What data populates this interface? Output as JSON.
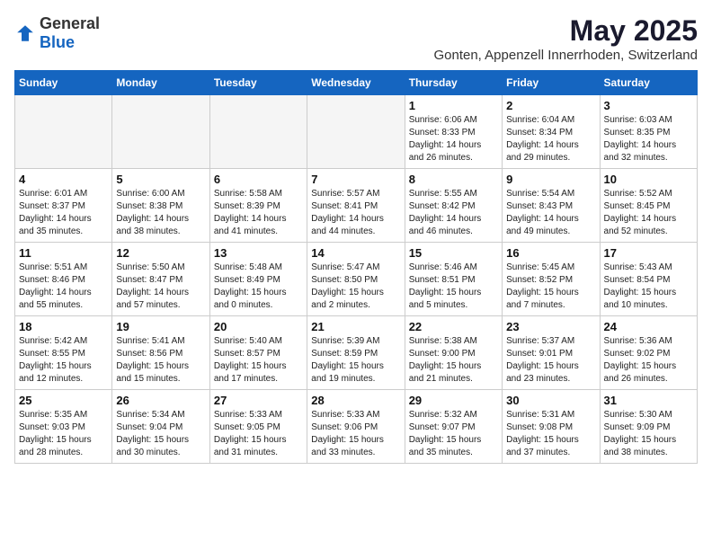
{
  "logo": {
    "general": "General",
    "blue": "Blue"
  },
  "title": "May 2025",
  "location": "Gonten, Appenzell Innerrhoden, Switzerland",
  "headers": [
    "Sunday",
    "Monday",
    "Tuesday",
    "Wednesday",
    "Thursday",
    "Friday",
    "Saturday"
  ],
  "weeks": [
    [
      {
        "day": "",
        "info": ""
      },
      {
        "day": "",
        "info": ""
      },
      {
        "day": "",
        "info": ""
      },
      {
        "day": "",
        "info": ""
      },
      {
        "day": "1",
        "info": "Sunrise: 6:06 AM\nSunset: 8:33 PM\nDaylight: 14 hours\nand 26 minutes."
      },
      {
        "day": "2",
        "info": "Sunrise: 6:04 AM\nSunset: 8:34 PM\nDaylight: 14 hours\nand 29 minutes."
      },
      {
        "day": "3",
        "info": "Sunrise: 6:03 AM\nSunset: 8:35 PM\nDaylight: 14 hours\nand 32 minutes."
      }
    ],
    [
      {
        "day": "4",
        "info": "Sunrise: 6:01 AM\nSunset: 8:37 PM\nDaylight: 14 hours\nand 35 minutes."
      },
      {
        "day": "5",
        "info": "Sunrise: 6:00 AM\nSunset: 8:38 PM\nDaylight: 14 hours\nand 38 minutes."
      },
      {
        "day": "6",
        "info": "Sunrise: 5:58 AM\nSunset: 8:39 PM\nDaylight: 14 hours\nand 41 minutes."
      },
      {
        "day": "7",
        "info": "Sunrise: 5:57 AM\nSunset: 8:41 PM\nDaylight: 14 hours\nand 44 minutes."
      },
      {
        "day": "8",
        "info": "Sunrise: 5:55 AM\nSunset: 8:42 PM\nDaylight: 14 hours\nand 46 minutes."
      },
      {
        "day": "9",
        "info": "Sunrise: 5:54 AM\nSunset: 8:43 PM\nDaylight: 14 hours\nand 49 minutes."
      },
      {
        "day": "10",
        "info": "Sunrise: 5:52 AM\nSunset: 8:45 PM\nDaylight: 14 hours\nand 52 minutes."
      }
    ],
    [
      {
        "day": "11",
        "info": "Sunrise: 5:51 AM\nSunset: 8:46 PM\nDaylight: 14 hours\nand 55 minutes."
      },
      {
        "day": "12",
        "info": "Sunrise: 5:50 AM\nSunset: 8:47 PM\nDaylight: 14 hours\nand 57 minutes."
      },
      {
        "day": "13",
        "info": "Sunrise: 5:48 AM\nSunset: 8:49 PM\nDaylight: 15 hours\nand 0 minutes."
      },
      {
        "day": "14",
        "info": "Sunrise: 5:47 AM\nSunset: 8:50 PM\nDaylight: 15 hours\nand 2 minutes."
      },
      {
        "day": "15",
        "info": "Sunrise: 5:46 AM\nSunset: 8:51 PM\nDaylight: 15 hours\nand 5 minutes."
      },
      {
        "day": "16",
        "info": "Sunrise: 5:45 AM\nSunset: 8:52 PM\nDaylight: 15 hours\nand 7 minutes."
      },
      {
        "day": "17",
        "info": "Sunrise: 5:43 AM\nSunset: 8:54 PM\nDaylight: 15 hours\nand 10 minutes."
      }
    ],
    [
      {
        "day": "18",
        "info": "Sunrise: 5:42 AM\nSunset: 8:55 PM\nDaylight: 15 hours\nand 12 minutes."
      },
      {
        "day": "19",
        "info": "Sunrise: 5:41 AM\nSunset: 8:56 PM\nDaylight: 15 hours\nand 15 minutes."
      },
      {
        "day": "20",
        "info": "Sunrise: 5:40 AM\nSunset: 8:57 PM\nDaylight: 15 hours\nand 17 minutes."
      },
      {
        "day": "21",
        "info": "Sunrise: 5:39 AM\nSunset: 8:59 PM\nDaylight: 15 hours\nand 19 minutes."
      },
      {
        "day": "22",
        "info": "Sunrise: 5:38 AM\nSunset: 9:00 PM\nDaylight: 15 hours\nand 21 minutes."
      },
      {
        "day": "23",
        "info": "Sunrise: 5:37 AM\nSunset: 9:01 PM\nDaylight: 15 hours\nand 23 minutes."
      },
      {
        "day": "24",
        "info": "Sunrise: 5:36 AM\nSunset: 9:02 PM\nDaylight: 15 hours\nand 26 minutes."
      }
    ],
    [
      {
        "day": "25",
        "info": "Sunrise: 5:35 AM\nSunset: 9:03 PM\nDaylight: 15 hours\nand 28 minutes."
      },
      {
        "day": "26",
        "info": "Sunrise: 5:34 AM\nSunset: 9:04 PM\nDaylight: 15 hours\nand 30 minutes."
      },
      {
        "day": "27",
        "info": "Sunrise: 5:33 AM\nSunset: 9:05 PM\nDaylight: 15 hours\nand 31 minutes."
      },
      {
        "day": "28",
        "info": "Sunrise: 5:33 AM\nSunset: 9:06 PM\nDaylight: 15 hours\nand 33 minutes."
      },
      {
        "day": "29",
        "info": "Sunrise: 5:32 AM\nSunset: 9:07 PM\nDaylight: 15 hours\nand 35 minutes."
      },
      {
        "day": "30",
        "info": "Sunrise: 5:31 AM\nSunset: 9:08 PM\nDaylight: 15 hours\nand 37 minutes."
      },
      {
        "day": "31",
        "info": "Sunrise: 5:30 AM\nSunset: 9:09 PM\nDaylight: 15 hours\nand 38 minutes."
      }
    ]
  ]
}
